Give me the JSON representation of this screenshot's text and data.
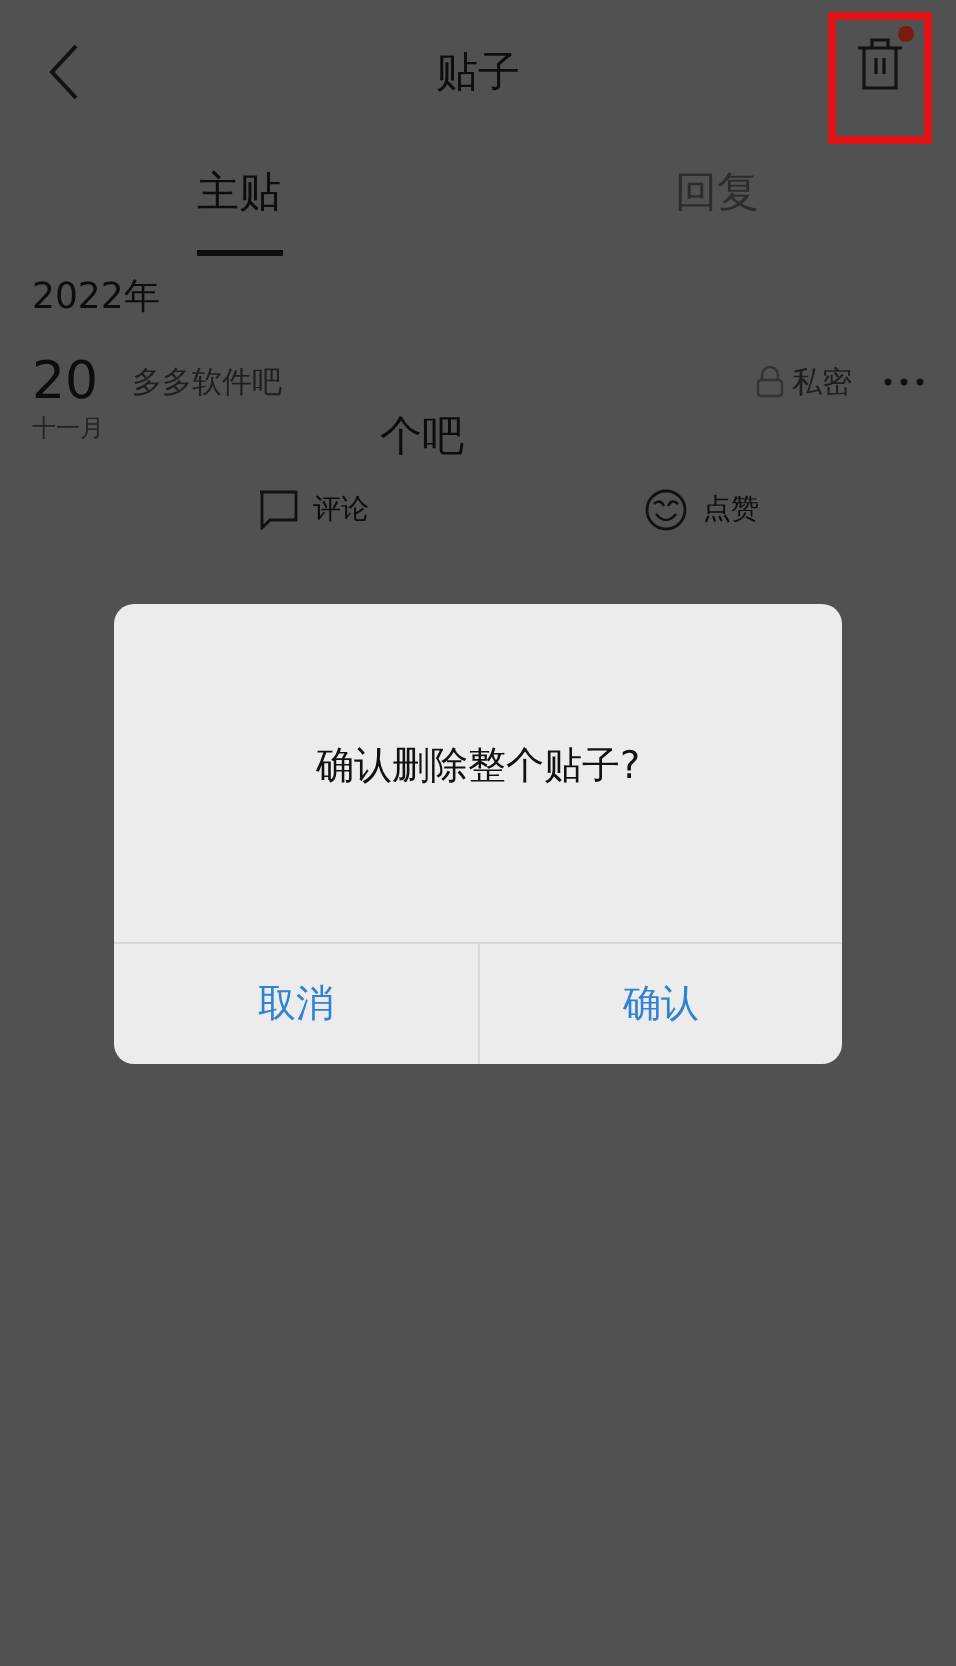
{
  "header": {
    "title": "贴子",
    "delete_button": {
      "highlighted": true,
      "badge": true
    }
  },
  "tabs": [
    {
      "label": "主贴",
      "selected": true
    },
    {
      "label": "回复",
      "selected": false
    }
  ],
  "year": "2022年",
  "post": {
    "day": "20",
    "month": "十一月",
    "forum": "多多软件吧",
    "privacy": "私密",
    "content": "个吧",
    "actions": [
      {
        "kind": "comment",
        "label": "评论"
      },
      {
        "kind": "like",
        "label": "点赞"
      }
    ]
  },
  "dialog": {
    "message": "确认删除整个贴子?",
    "buttons": [
      "取消",
      "确认"
    ]
  }
}
